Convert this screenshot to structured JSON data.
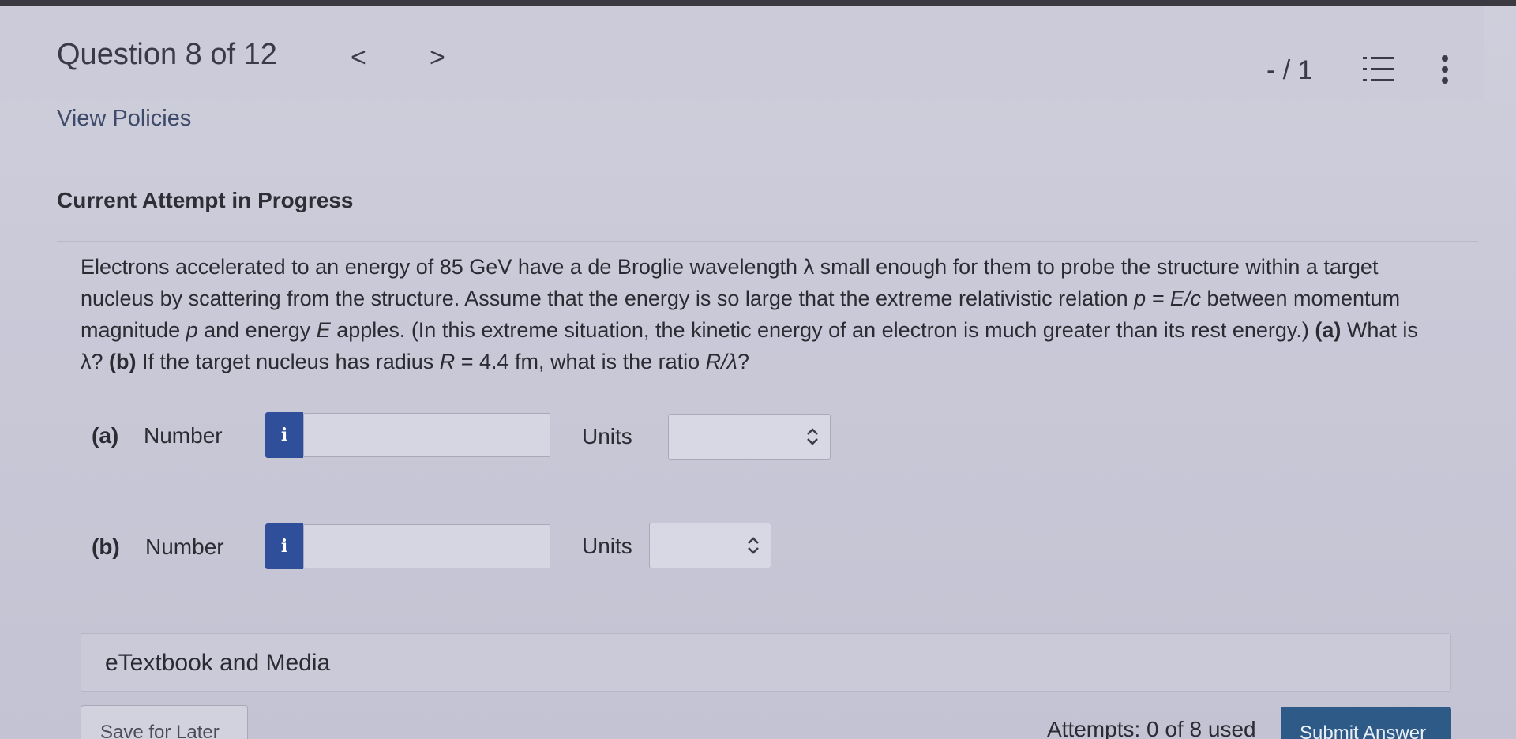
{
  "header": {
    "title": "Question 8 of 12",
    "prev_label": "<",
    "next_label": ">",
    "score": "- / 1"
  },
  "policies_link": "View Policies",
  "attempt_status": "Current Attempt in Progress",
  "question": {
    "line1": "Electrons accelerated to an energy of 85 GeV have a de Broglie wavelength λ small enough for them to probe the structure within a target nucleus by scattering from the structure. Assume that the energy is so large that the extreme relativistic relation ",
    "eq1": "p = E/c",
    "line2": " between momentum magnitude ",
    "var_p": "p",
    "line3": " and energy ",
    "var_E": "E",
    "line4": " apples. (In this extreme situation, the kinetic energy of an electron is much greater than its rest energy.) ",
    "part_a_tag": "(a)",
    "part_a_q": " What is λ? ",
    "part_b_tag": "(b)",
    "part_b_q": " If the target nucleus has radius ",
    "eq2": "R",
    "eq2_val": " = 4.4 fm, what is the ratio ",
    "eq3": "R/λ",
    "end": "?"
  },
  "parts": [
    {
      "tag": "(a)",
      "number_label": "Number",
      "info_label": "i",
      "number_value": "",
      "units_label": "Units",
      "units_value": ""
    },
    {
      "tag": "(b)",
      "number_label": "Number",
      "info_label": "i",
      "number_value": "",
      "units_label": "Units",
      "units_value": ""
    }
  ],
  "etextbook_label": "eTextbook and Media",
  "footer": {
    "save_label": "Save for Later",
    "attempts_text": "Attempts: 0 of 8 used",
    "submit_label": "Submit Answer"
  },
  "colors": {
    "info_button": "#2f4f9a",
    "submit_button": "#2e5a88"
  }
}
